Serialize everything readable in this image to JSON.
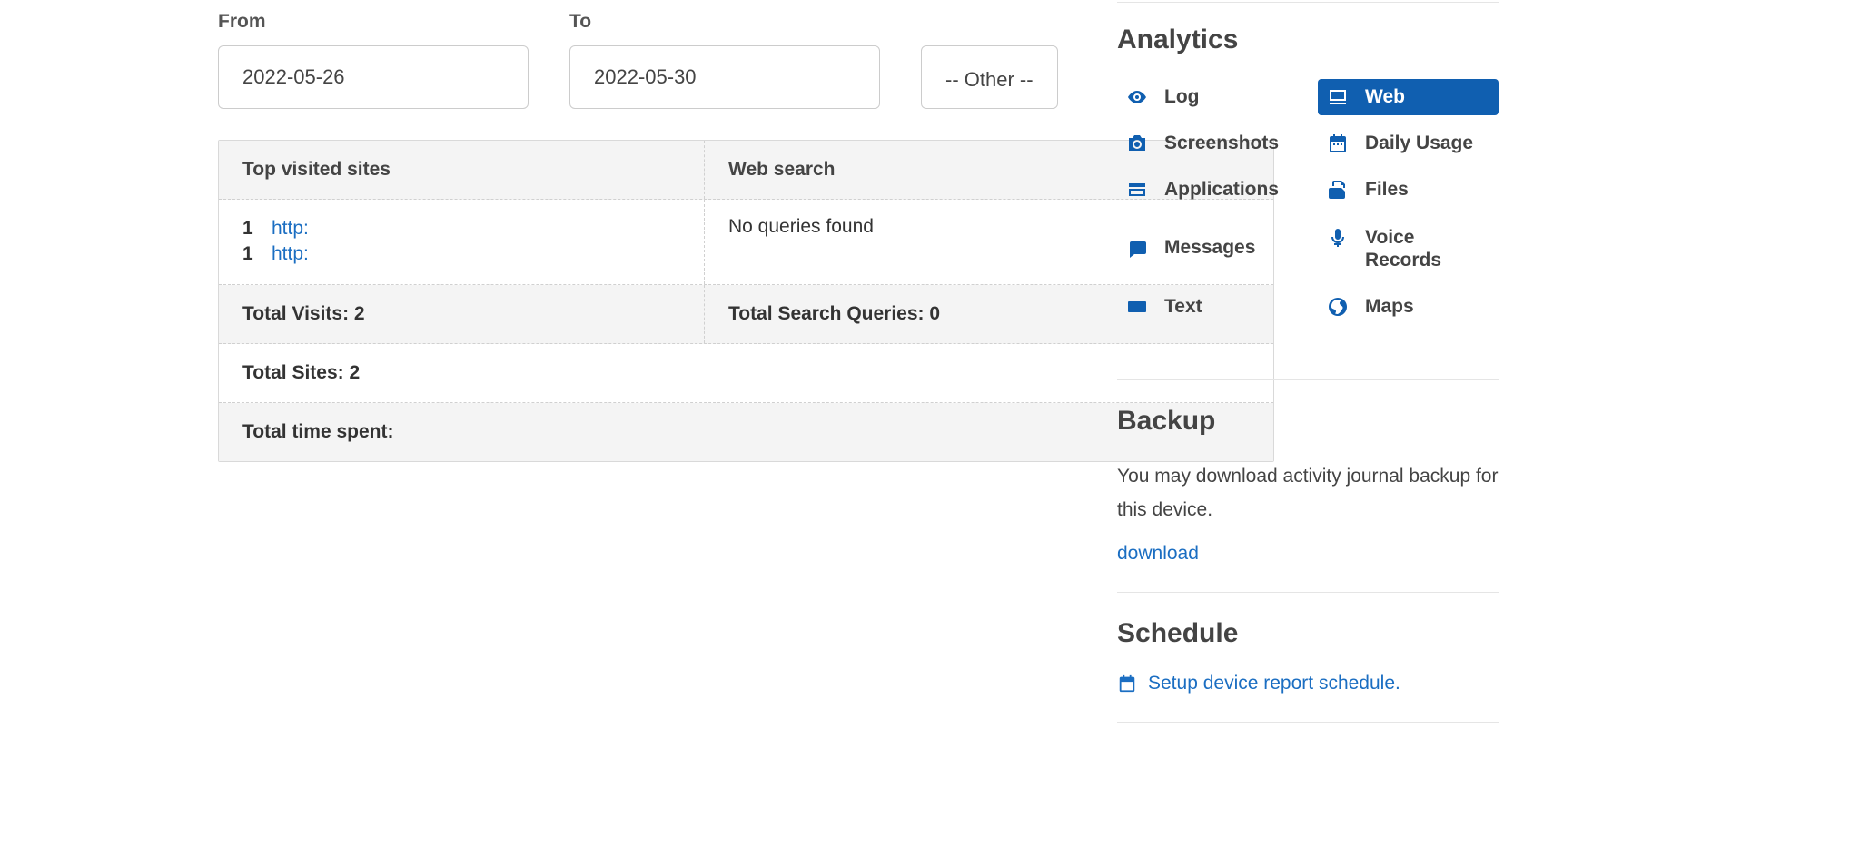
{
  "filters": {
    "from_label": "From",
    "from_value": "2022-05-26",
    "to_label": "To",
    "to_value": "2022-05-30",
    "other_value": "-- Other --"
  },
  "table": {
    "col_left_header": "Top visited sites",
    "col_right_header": "Web search",
    "sites": [
      {
        "count": "1",
        "url": "http:"
      },
      {
        "count": "1",
        "url": "http:"
      }
    ],
    "no_queries": "No queries found",
    "total_visits": "Total Visits: 2",
    "total_queries": "Total Search Queries: 0",
    "total_sites": "Total Sites: 2",
    "total_time": "Total time spent:"
  },
  "sidebar": {
    "analytics_heading": "Analytics",
    "nav": {
      "log": "Log",
      "web": "Web",
      "screenshots": "Screenshots",
      "daily_usage": "Daily Usage",
      "applications": "Applications",
      "files": "Files",
      "messages": "Messages",
      "voice_records_1": "Voice",
      "voice_records_2": "Records",
      "text": "Text",
      "maps": "Maps"
    },
    "backup_heading": "Backup",
    "backup_text": "You may download activity journal backup for this device.",
    "backup_link": "download",
    "schedule_heading": "Schedule",
    "schedule_link": "Setup device report schedule."
  }
}
